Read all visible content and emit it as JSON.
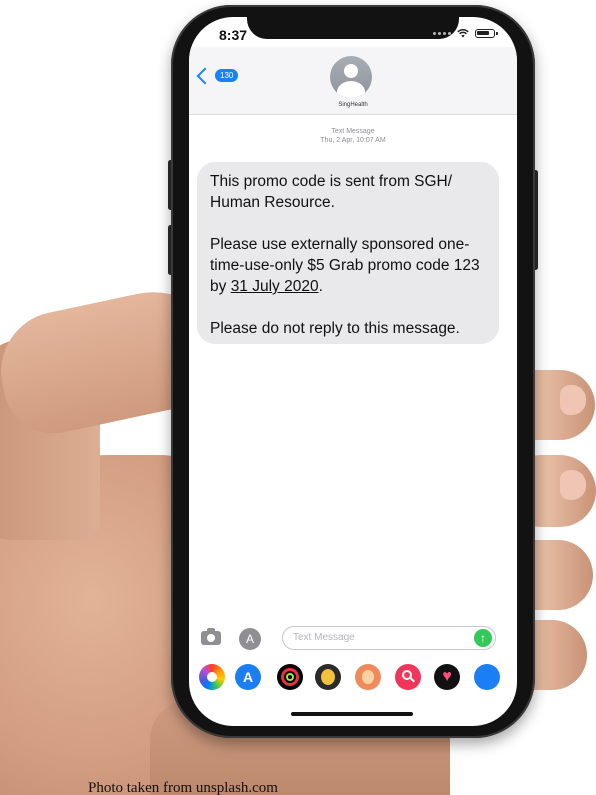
{
  "status_bar": {
    "time": "8:37"
  },
  "header": {
    "back_badge": "130",
    "contact_name": "SingHealth"
  },
  "thread": {
    "message_type": "Text Message",
    "timestamp": "Thu, 2 Apr, 10:07 AM",
    "message": {
      "line1": "This promo code is sent from SGH/ Human Resource.",
      "line2_pre": "Please use externally sponsored one-time-use-only $5 Grab promo code 123 by ",
      "line2_date": "31 July 2020",
      "line2_post": ".",
      "line3": "Please do not reply to this message."
    }
  },
  "input": {
    "placeholder": "Text Message"
  },
  "app_drawer": {
    "icons": [
      "photos-icon",
      "app-store-icon",
      "activity-icon",
      "memoji-icon",
      "memoji-icon",
      "search-icon",
      "heart-icon"
    ]
  },
  "caption": "Photo taken from unsplash.com",
  "colors": {
    "ios_blue": "#1a82f7",
    "send_green": "#34c759",
    "bubble_gray": "#e9e9eb"
  }
}
